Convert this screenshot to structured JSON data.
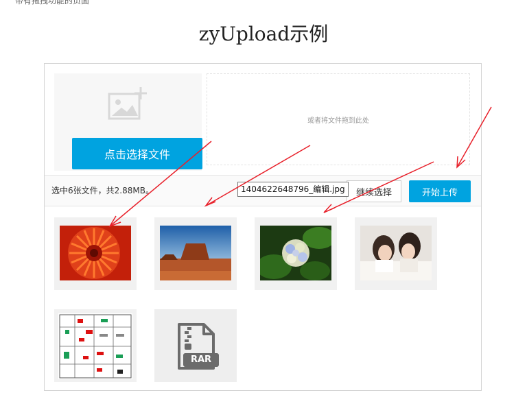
{
  "page": {
    "top_note": "带有拖拽功能的页面",
    "title": "zyUpload示例"
  },
  "uploader": {
    "choose_button": "点击选择文件",
    "drop_hint": "或者将文件拖到此处",
    "status": "选中6张文件，共2.88MB。",
    "continue_button": "继续选择",
    "upload_button": "开始上传",
    "tooltip": "1404622648796_编辑.jpg",
    "rar_label": "RAR"
  },
  "thumbnails": [
    {
      "subject": "red chrysanthemum flower"
    },
    {
      "subject": "desert butte landscape"
    },
    {
      "subject": "white hydrangea flowers"
    },
    {
      "subject": "two children on bed"
    },
    {
      "subject": "floor plan drawing"
    },
    {
      "subject": "rar archive file",
      "icon": "rar-file-icon"
    }
  ],
  "colors": {
    "accent": "#00a3e0",
    "arrow": "#e8202a",
    "panel_border": "#d4d4d4"
  }
}
